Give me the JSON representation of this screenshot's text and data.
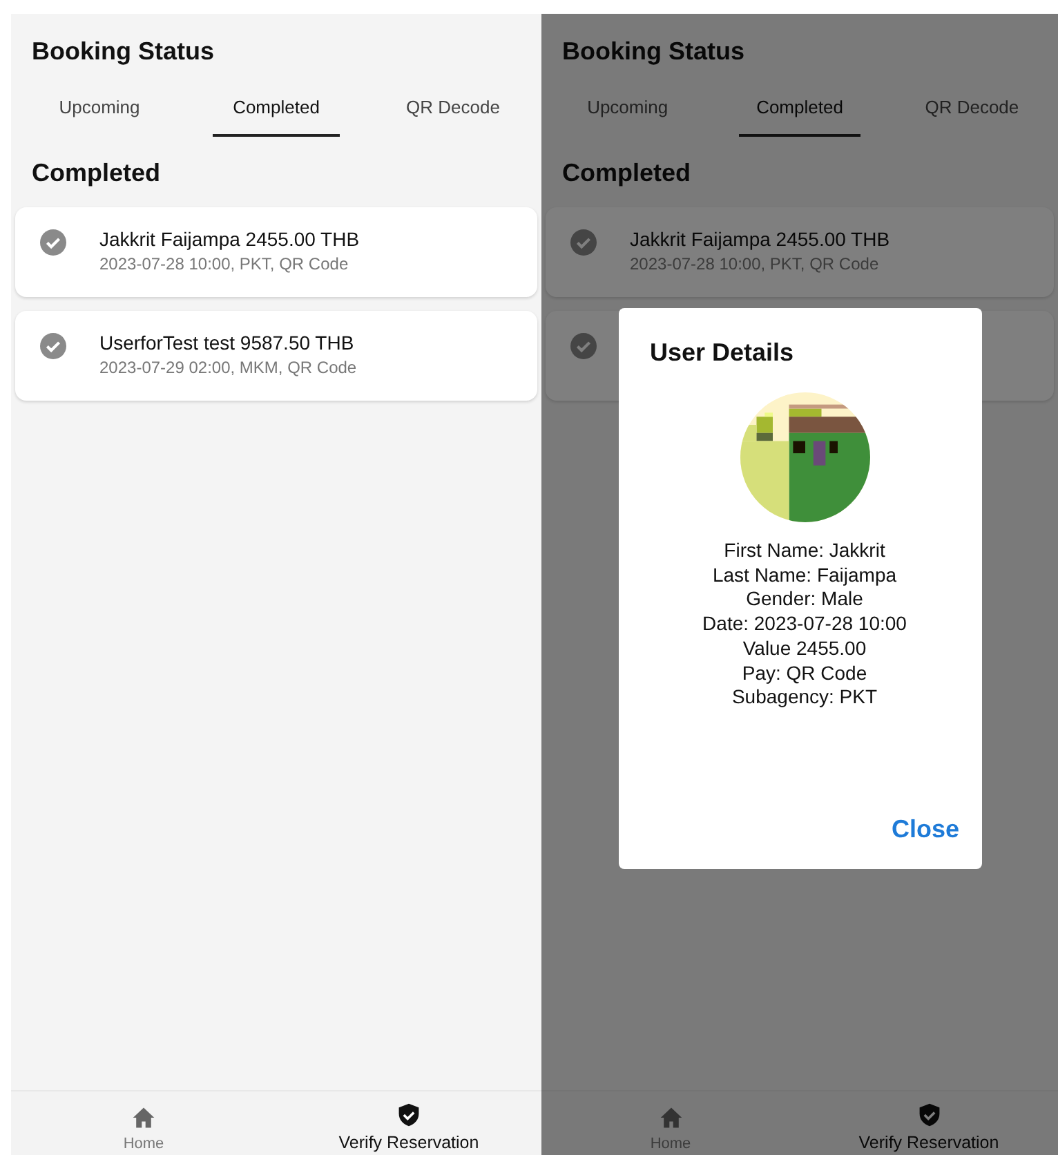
{
  "screens": [
    {
      "title": "Booking Status",
      "tabs": [
        {
          "label": "Upcoming",
          "selected": false
        },
        {
          "label": "Completed",
          "selected": true
        },
        {
          "label": "QR Decode",
          "selected": false
        }
      ],
      "heading": "Completed",
      "bookings": [
        {
          "kind": "completed",
          "title": "Jakkrit Faijampa 2455.00 THB",
          "subtitle": "2023-07-28 10:00, PKT, QR Code"
        },
        {
          "kind": "completed",
          "title": "UserforTest test 9587.50 THB",
          "subtitle": "2023-07-29 02:00, MKM, QR Code"
        }
      ],
      "nav": [
        {
          "kind": "home",
          "label": "Home",
          "selected": false
        },
        {
          "kind": "verify",
          "label": "Verify Reservation",
          "selected": true
        }
      ]
    },
    {
      "title": "Booking Status",
      "tabs": [
        {
          "label": "Upcoming",
          "selected": false
        },
        {
          "label": "Completed",
          "selected": true
        },
        {
          "label": "QR Decode",
          "selected": false
        }
      ],
      "heading": "Completed",
      "bookings": [
        {
          "kind": "completed",
          "title": "Jakkrit Faijampa 2455.00 THB",
          "subtitle": "2023-07-28 10:00, PKT, QR Code"
        },
        {
          "kind": "completed"
        }
      ],
      "nav": [
        {
          "kind": "home",
          "label": "Home",
          "selected": false
        },
        {
          "kind": "verify",
          "label": "Verify Reservation",
          "selected": true
        }
      ],
      "dialog": {
        "title": "User Details",
        "lines": [
          "First Name: Jakkrit",
          "Last Name: Faijampa",
          "Gender: Male",
          "Date: 2023-07-28 10:00",
          "Value 2455.00",
          "Pay: QR Code",
          "Subagency: PKT"
        ],
        "button": "Close"
      }
    }
  ]
}
